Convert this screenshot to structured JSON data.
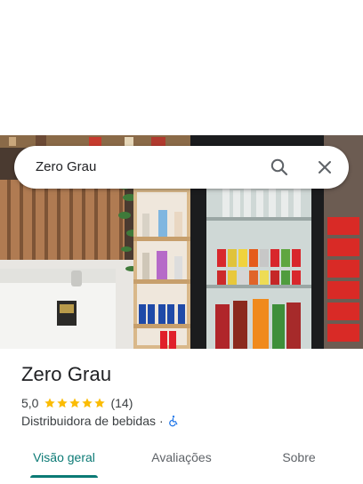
{
  "search": {
    "query": "Zero Grau"
  },
  "place": {
    "name": "Zero Grau",
    "rating": "5,0",
    "stars": 5,
    "review_count": "(14)",
    "category": "Distribuidora de bebidas",
    "separator": "·"
  },
  "tabs": [
    {
      "label": "Visão geral",
      "active": true
    },
    {
      "label": "Avaliações",
      "active": false
    },
    {
      "label": "Sobre",
      "active": false
    }
  ],
  "colors": {
    "accent": "#0b7a75",
    "star": "#fbbc04",
    "accessible": "#1a73e8"
  },
  "icons": {
    "search": "search-icon",
    "close": "close-icon",
    "accessibility": "wheelchair-icon",
    "rating": "star-icon"
  }
}
